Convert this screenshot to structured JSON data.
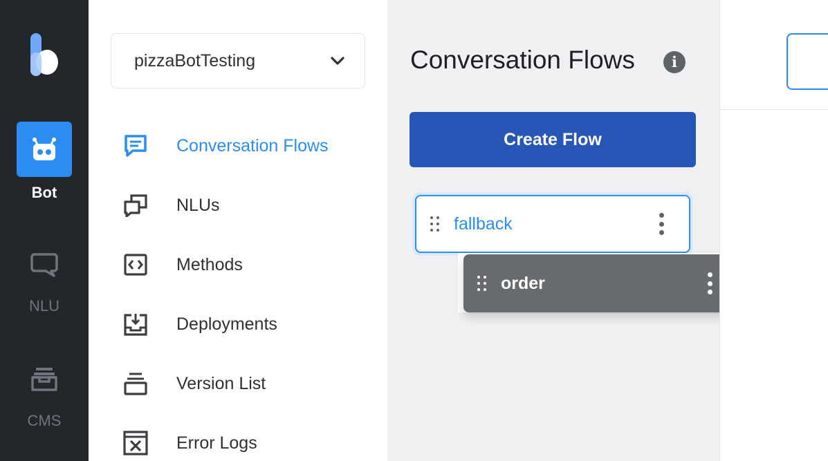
{
  "colors": {
    "rail_bg": "#23262b",
    "accent": "#2d8cf0",
    "primary_button": "#2856b6",
    "panel_bg": "#eef0f1",
    "drag_card_bg": "#676b6e"
  },
  "rail": {
    "logo": "kore-logo",
    "items": [
      {
        "label": "Bot",
        "icon": "bot-icon",
        "active": true
      },
      {
        "label": "NLU",
        "icon": "chat-bubble-icon",
        "active": false
      },
      {
        "label": "CMS",
        "icon": "inbox-tray-icon",
        "active": false
      }
    ]
  },
  "bot_selector": {
    "value": "pizzaBotTesting",
    "icon": "chevron-down-icon"
  },
  "nav": {
    "items": [
      {
        "label": "Conversation Flows",
        "icon": "message-square-icon",
        "active": true
      },
      {
        "label": "NLUs",
        "icon": "stacked-chat-icon",
        "active": false
      },
      {
        "label": "Methods",
        "icon": "code-brackets-icon",
        "active": false
      },
      {
        "label": "Deployments",
        "icon": "download-tray-icon",
        "active": false
      },
      {
        "label": "Version List",
        "icon": "layers-icon",
        "active": false
      },
      {
        "label": "Error Logs",
        "icon": "error-window-icon",
        "active": false
      }
    ]
  },
  "flows_panel": {
    "title": "Conversation Flows",
    "info_icon": "i",
    "create_button": "Create Flow",
    "flows": [
      {
        "name": "fallback",
        "state": "selected"
      }
    ],
    "dragging_flow": {
      "name": "order",
      "state": "dragging"
    }
  }
}
